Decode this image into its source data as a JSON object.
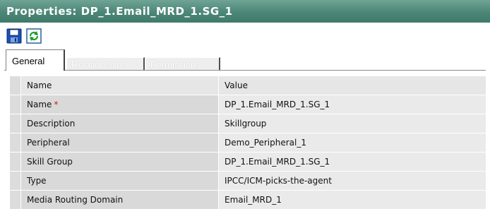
{
  "window": {
    "title": "Properties: DP_1.Email_MRD_1.SG_1"
  },
  "toolbar": {
    "save_icon": "save-icon",
    "refresh_icon": "refresh-icon"
  },
  "tabs": [
    {
      "label": "General",
      "active": true
    },
    {
      "label": "Relationships",
      "active": false
    },
    {
      "label": "Permissions",
      "active": false
    }
  ],
  "grid": {
    "headers": {
      "name": "Name",
      "value": "Value"
    },
    "rows": [
      {
        "name": "Name",
        "required_marker": "*",
        "value": "DP_1.Email_MRD_1.SG_1"
      },
      {
        "name": "Description",
        "value": "Skillgroup"
      },
      {
        "name": "Peripheral",
        "value": "Demo_Peripheral_1"
      },
      {
        "name": "Skill Group",
        "value": "DP_1.Email_MRD_1.SG_1"
      },
      {
        "name": "Type",
        "value": "IPCC/ICM-picks-the-agent"
      },
      {
        "name": "Media Routing Domain",
        "value": "Email_MRD_1"
      }
    ]
  },
  "colors": {
    "titlebar": "#4b8676",
    "required": "#d11a1a"
  }
}
